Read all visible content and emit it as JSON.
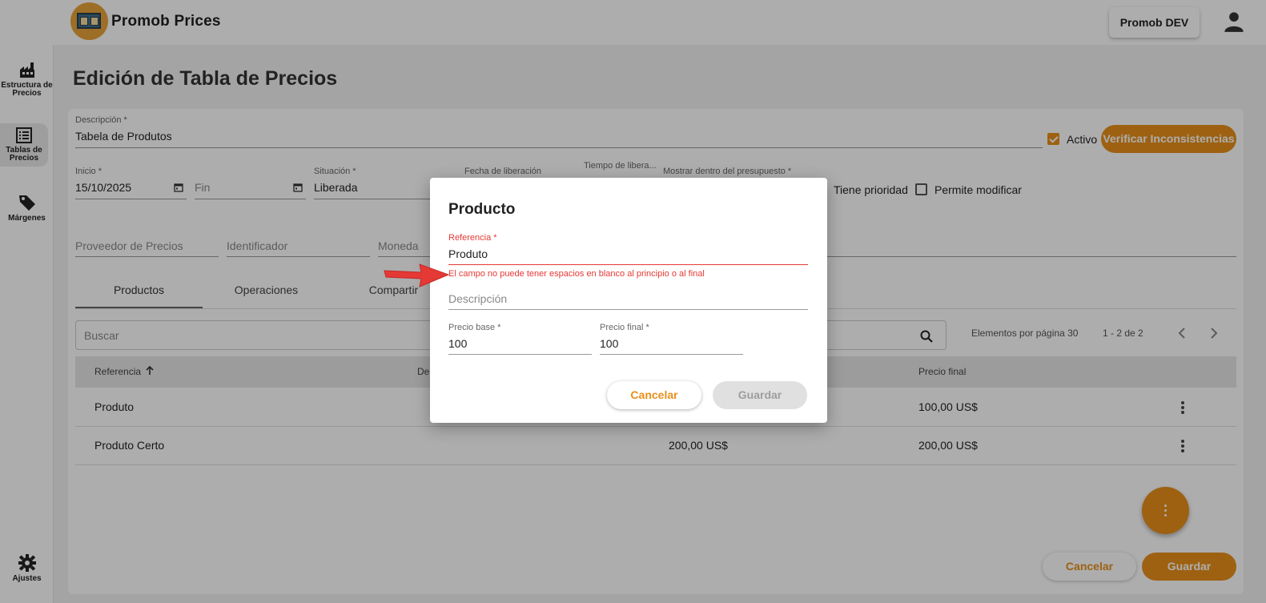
{
  "app": {
    "title": "Promob Prices",
    "environment_button": "Promob DEV"
  },
  "sidebar": {
    "items": [
      {
        "label_line1": "Estructura de",
        "label_line2": "Precios",
        "icon": "factory-icon"
      },
      {
        "label_line1": "Tablas de",
        "label_line2": "Precios",
        "icon": "list-icon"
      },
      {
        "label_line1": "Márgenes",
        "label_line2": "",
        "icon": "tag-icon"
      },
      {
        "label_line1": "Ajustes",
        "label_line2": "",
        "icon": "gear-icon"
      }
    ]
  },
  "page": {
    "title": "Edición de Tabla de Precios"
  },
  "form": {
    "descripcion_label": "Descripción *",
    "descripcion_value": "Tabela de Produtos",
    "activo_label": "Activo",
    "activo_checked": true,
    "verify_button": "Verificar Inconsistencias",
    "inicio_label": "Inicio *",
    "inicio_value": "15/10/2025",
    "fin_placeholder": "Fin",
    "situacion_label": "Situación *",
    "situacion_value": "Liberada",
    "fecha_liberacion_label": "Fecha de liberación",
    "tiempo_liberacion_label": "Tiempo de libera...",
    "mostrar_label": "Mostrar dentro del presupuesto *",
    "tiene_prioridad_label": "Tiene prioridad",
    "permite_modificar_label": "Permite modificar",
    "proveedor_placeholder": "Proveedor de Precios",
    "identificador_placeholder": "Identificador",
    "moneda_placeholder": "Moneda"
  },
  "tabs": [
    {
      "label": "Productos",
      "active": true
    },
    {
      "label": "Operaciones",
      "active": false
    },
    {
      "label": "Compartir",
      "active": false
    }
  ],
  "search": {
    "placeholder": "Buscar"
  },
  "pager": {
    "per_page_label": "Elementos por página 30",
    "range_label": "1 - 2 de 2"
  },
  "table": {
    "headers": {
      "referencia": "Referencia",
      "descripcion": "De",
      "precio_final": "Precio final"
    },
    "rows": [
      {
        "referencia": "Produto",
        "precio_base": "",
        "precio_final": "100,00 US$"
      },
      {
        "referencia": "Produto Certo",
        "precio_base": "200,00 US$",
        "precio_final": "200,00 US$"
      }
    ]
  },
  "footer": {
    "cancel_button": "Cancelar",
    "save_button": "Guardar"
  },
  "dialog": {
    "title": "Producto",
    "referencia_label": "Referencia *",
    "referencia_value": "Produto",
    "referencia_error": "El campo no puede tener espacios en blanco al principio o al final",
    "descripcion_placeholder": "Descripción",
    "precio_base_label": "Precio base *",
    "precio_base_value": "100",
    "precio_final_label": "Precio final *",
    "precio_final_value": "100",
    "cancel_button": "Cancelar",
    "save_button": "Guardar"
  },
  "colors": {
    "accent": "#e8901a",
    "error": "#e53935",
    "annotation_arrow": "#e53935"
  }
}
